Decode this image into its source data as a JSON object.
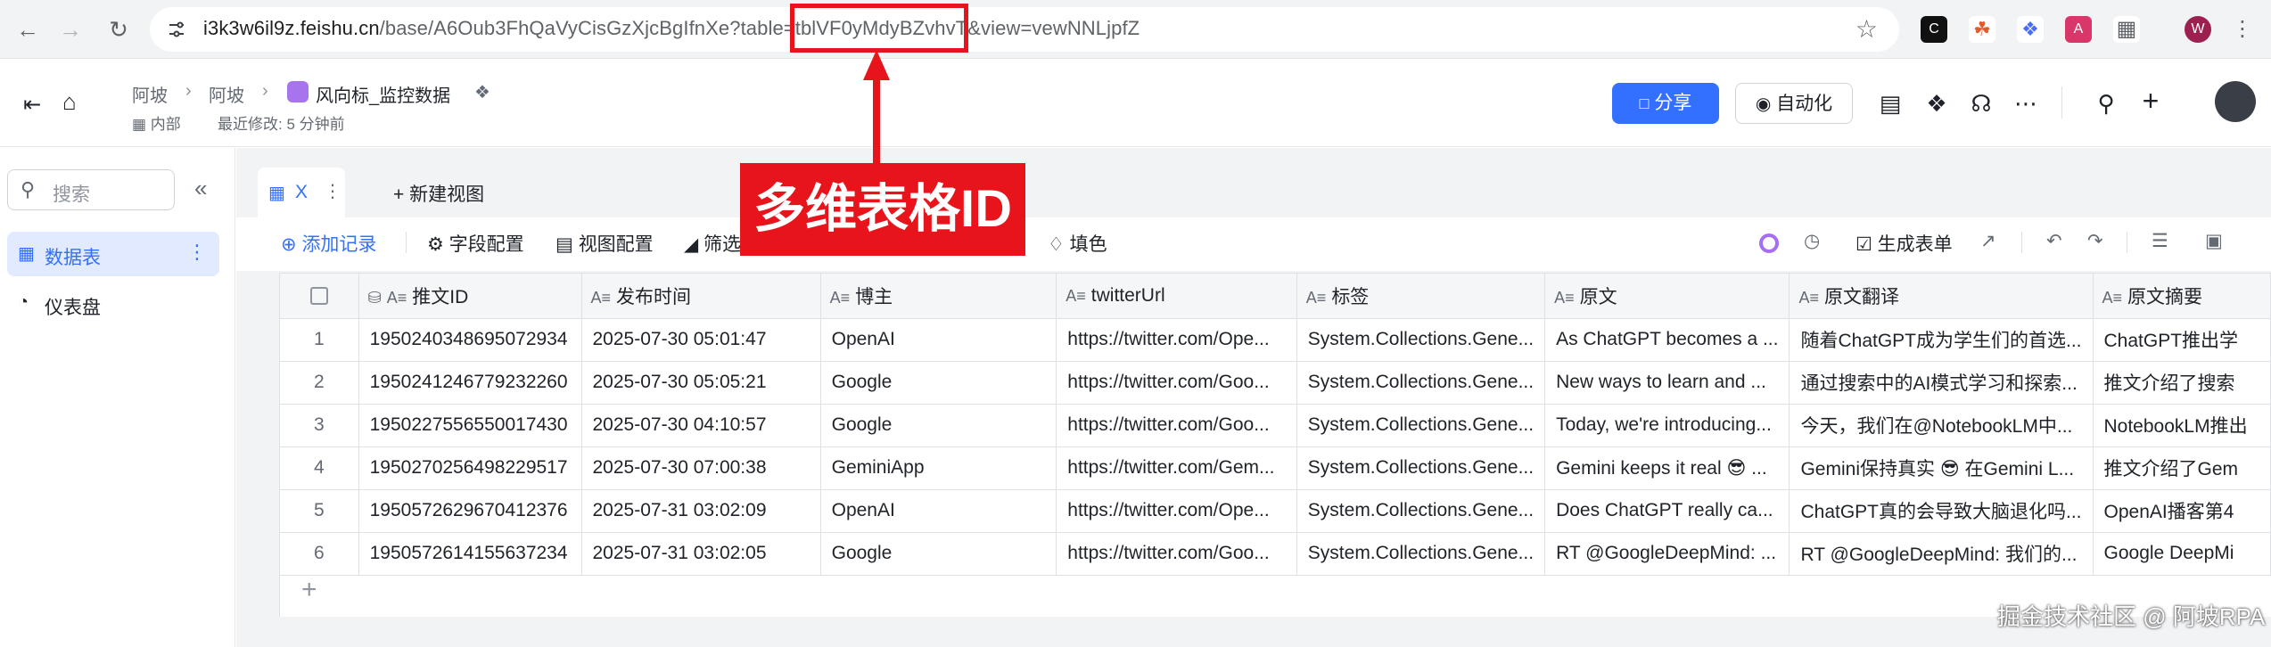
{
  "browser": {
    "url_host": "i3k3w6il9z.feishu.cn",
    "url_path": "/base/A6Oub3FhQaVyCisGzXjcBgIfnXe?table=",
    "url_table": "tblVF0yMdyBZvhvT",
    "url_rest": "&view=vewNNLjpfZ",
    "profile_initial": "W"
  },
  "header": {
    "crumbs": [
      "阿坡",
      "阿坡",
      "风向标_监控数据"
    ],
    "visibility": "内部",
    "modified": "最近修改: 5 分钟前",
    "share_label": "分享",
    "automation_label": "自动化"
  },
  "sidebar": {
    "search_placeholder": "搜索",
    "items": [
      {
        "label": "数据表"
      },
      {
        "label": "仪表盘"
      }
    ]
  },
  "main": {
    "view_tab": "X",
    "new_view": "新建视图",
    "toolbar": {
      "add_record": "添加记录",
      "field_config": "字段配置",
      "view_config": "视图配置",
      "filter": "筛选",
      "fill_color": "填色",
      "generate_form": "生成表单"
    }
  },
  "table": {
    "columns": [
      "推文ID",
      "发布时间",
      "博主",
      "twitterUrl",
      "标签",
      "原文",
      "原文翻译",
      "原文摘要"
    ],
    "rows": [
      [
        "1",
        "1950240348695072934",
        "2025-07-30 05:01:47",
        "OpenAI",
        "https://twitter.com/Ope...",
        "System.Collections.Gene...",
        "As ChatGPT becomes a ...",
        "随着ChatGPT成为学生们的首选...",
        "ChatGPT推出学"
      ],
      [
        "2",
        "1950241246779232260",
        "2025-07-30 05:05:21",
        "Google",
        "https://twitter.com/Goo...",
        "System.Collections.Gene...",
        "New ways to learn and ...",
        "通过搜索中的AI模式学习和探索...",
        "推文介绍了搜索"
      ],
      [
        "3",
        "1950227556550017430",
        "2025-07-30 04:10:57",
        "Google",
        "https://twitter.com/Goo...",
        "System.Collections.Gene...",
        "Today, we're introducing...",
        "今天，我们在@NotebookLM中...",
        "NotebookLM推出"
      ],
      [
        "4",
        "1950270256498229517",
        "2025-07-30 07:00:38",
        "GeminiApp",
        "https://twitter.com/Gem...",
        "System.Collections.Gene...",
        "Gemini keeps it real 😎 ...",
        "Gemini保持真实 😎 在Gemini L...",
        "推文介绍了Gem"
      ],
      [
        "5",
        "1950572629670412376",
        "2025-07-31 03:02:09",
        "OpenAI",
        "https://twitter.com/Ope...",
        "System.Collections.Gene...",
        "Does ChatGPT really ca...",
        "ChatGPT真的会导致大脑退化吗...",
        "OpenAI播客第4"
      ],
      [
        "6",
        "1950572614155637234",
        "2025-07-31 03:02:05",
        "Google",
        "https://twitter.com/Goo...",
        "System.Collections.Gene...",
        "RT @GoogleDeepMind: ...",
        "RT @GoogleDeepMind: 我们的...",
        "Google DeepMi"
      ]
    ]
  },
  "annotation": {
    "callout": "多维表格ID",
    "watermark": "掘金技术社区 @ 阿坡RPA"
  },
  "colors": {
    "accent": "#3370ff",
    "annotation_red": "#e8141b"
  }
}
